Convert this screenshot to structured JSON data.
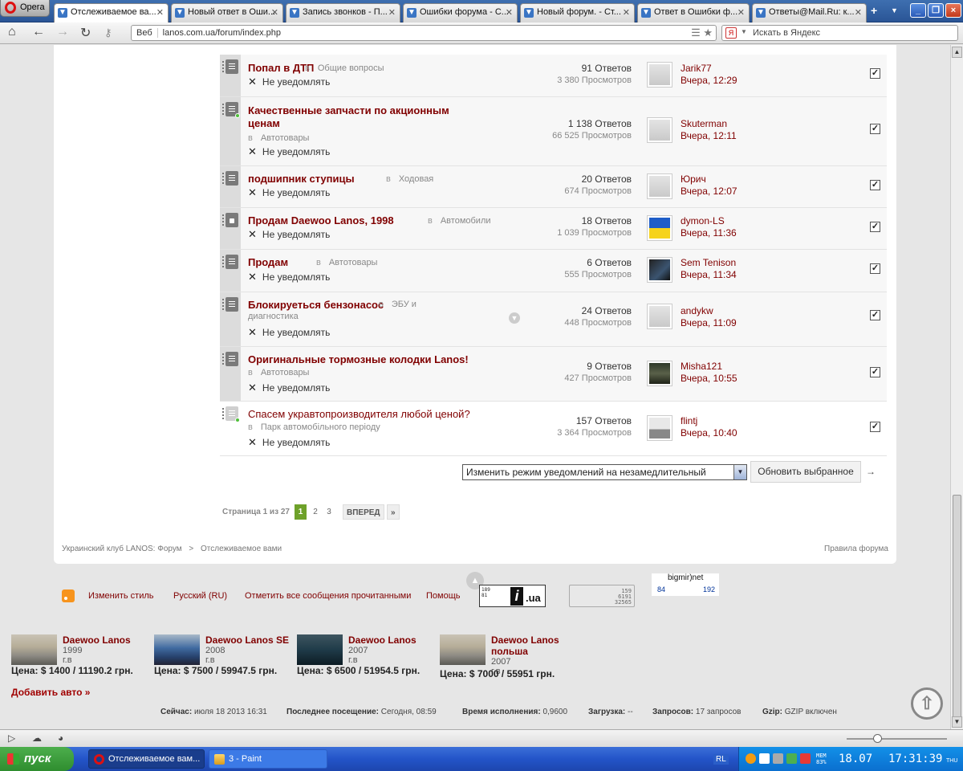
{
  "browser": {
    "app_name": "Opera",
    "tabs": [
      {
        "label": "Отслеживаемое ва...",
        "active": true,
        "icon": "forum-tab-icon"
      },
      {
        "label": "Новый ответ в Оши...",
        "active": false,
        "icon": "mail-tab-icon"
      },
      {
        "label": "Запись звонков - П...",
        "active": false,
        "icon": "play-tab-icon"
      },
      {
        "label": "Ошибки форума - С...",
        "active": false,
        "icon": "forum-tab-icon"
      },
      {
        "label": "Новый форум. - Ст...",
        "active": false,
        "icon": "forum-tab-icon"
      },
      {
        "label": "Ответ в Ошибки ф...",
        "active": false,
        "icon": "forum-tab-icon"
      },
      {
        "label": "Ответы@Mail.Ru: к...",
        "active": false,
        "icon": "mail-answers-tab-icon"
      }
    ],
    "address": {
      "badge": "Веб",
      "url": "lanos.com.ua/forum/index.php"
    },
    "search": {
      "placeholder": "Искать в Яндекс",
      "engine_badge": "Я"
    }
  },
  "threads": [
    {
      "title": "Попал в ДТП",
      "forum": "Общие вопросы",
      "notify": "Не уведомлять",
      "replies": "91 Ответов",
      "views": "3 380 Просмотров",
      "last_user": "Jarik77",
      "last_date": "Вчера, 12:29",
      "avatar": "default",
      "icon": "normal",
      "checked": true
    },
    {
      "title": "Качественные запчасти по акционным ценам",
      "forum": "Автотовары",
      "notify": "Не уведомлять",
      "replies": "1 138 Ответов",
      "views": "66 525 Просмотров",
      "last_user": "Skuterman",
      "last_date": "Вчера, 12:11",
      "avatar": "default",
      "icon": "new",
      "checked": true
    },
    {
      "title": "подшипник ступицы",
      "forum": "Ходовая",
      "notify": "Не уведомлять",
      "replies": "20 Ответов",
      "views": "674 Просмотров",
      "last_user": "Юрич",
      "last_date": "Вчера, 12:07",
      "avatar": "default",
      "icon": "normal",
      "checked": true
    },
    {
      "title": "Продам Daewoo Lanos, 1998",
      "forum": "Автомобили",
      "notify": "Не уведомлять",
      "replies": "18 Ответов",
      "views": "1 039 Просмотров",
      "last_user": "dymon-LS",
      "last_date": "Вчера, 11:36",
      "avatar": "flag",
      "icon": "locked",
      "checked": true
    },
    {
      "title": "Продам",
      "forum": "Автотовары",
      "notify": "Не уведомлять",
      "replies": "6 Ответов",
      "views": "555 Просмотров",
      "last_user": "Sem Tenison",
      "last_date": "Вчера, 11:34",
      "avatar": "car",
      "icon": "normal",
      "checked": true
    },
    {
      "title": "Блокируеться бензонасос",
      "forum": "ЭБУ и диагностика",
      "notify": "Не уведомлять",
      "replies": "24 Ответов",
      "views": "448 Просмотров",
      "last_user": "andykw",
      "last_date": "Вчера, 11:09",
      "avatar": "default",
      "icon": "normal",
      "checked": true
    },
    {
      "title": "Оригинальные тормозные колодки Lanos!",
      "forum": "Автотовары",
      "notify": "Не уведомлять",
      "replies": "9 Ответов",
      "views": "427 Просмотров",
      "last_user": "Misha121",
      "last_date": "Вчера, 10:55",
      "avatar": "dark",
      "icon": "normal",
      "checked": true
    },
    {
      "title": "Спасем укравтопроизводителя любой ценой?",
      "forum": "Парк автомобільного періоду",
      "notify": "Не уведомлять",
      "replies": "157 Ответов",
      "views": "3 364 Просмотров",
      "last_user": "flintj",
      "last_date": "Вчера, 10:40",
      "avatar": "plane",
      "icon": "read",
      "checked": true
    }
  ],
  "in_label": "в",
  "moderation": {
    "select_value": "Изменить режим уведомлений на незамедлительный",
    "update_button": "Обновить выбранное"
  },
  "pagination": {
    "label": "Страница 1 из 27",
    "current": "1",
    "pages": [
      "2",
      "3"
    ],
    "next": "ВПЕРЕД",
    "last": "»"
  },
  "breadcrumb": {
    "home": "Украинский клуб LANOS: Форум",
    "sep": ">",
    "current": "Отслеживаемое вами"
  },
  "rules_link": "Правила форума",
  "footer_links": [
    "Изменить стиль",
    "Русский (RU)",
    "Отметить все сообщения прочитанными",
    "Помощь"
  ],
  "counters": {
    "iua": {
      "lines": "189\n81",
      "letter": "i",
      "domain": ".ua"
    },
    "hits": {
      "a": "159",
      "b": "6191",
      "c": "32565"
    },
    "bigmir": {
      "title": "bigmir)net",
      "left": "84",
      "right": "192"
    }
  },
  "ads": [
    {
      "name": "Daewoo Lanos",
      "year": "1999 г.в",
      "price": "Цена: $ 1400 / 11190.2 грн.",
      "img": "silver"
    },
    {
      "name": "Daewoo Lanos SE",
      "year": "2008 г.в",
      "price": "Цена: $ 7500 / 59947.5 грн.",
      "img": "blue"
    },
    {
      "name": "Daewoo Lanos",
      "year": "2007 г.в",
      "price": "Цена: $ 6500 / 51954.5 грн.",
      "img": "teal"
    },
    {
      "name": "Daewoo Lanos польша",
      "year": "2007 г.в",
      "price": "Цена: $ 7000 / 55951 грн.",
      "img": "silver"
    }
  ],
  "add_car": "Добавить авто »",
  "server_stats": [
    {
      "label": "Сейчас:",
      "value": "июля 18 2013 16:31"
    },
    {
      "label": "Последнее посещение:",
      "value": "Сегодня, 08:59"
    },
    {
      "label": "Время исполнения:",
      "value": "0,9600"
    },
    {
      "label": "Загрузка:",
      "value": "--"
    },
    {
      "label": "Запросов:",
      "value": "17 запросов"
    },
    {
      "label": "Gzip:",
      "value": "GZIP включен"
    }
  ],
  "taskbar": {
    "start": "пуск",
    "tasks": [
      {
        "label": "Отслеживаемое вам...",
        "active": true
      },
      {
        "label": "3 - Paint",
        "active": false
      }
    ],
    "lang": "RL",
    "mem": "MEM\n83%",
    "date": "18.07",
    "time": "17:31:39",
    "day": "THU"
  }
}
